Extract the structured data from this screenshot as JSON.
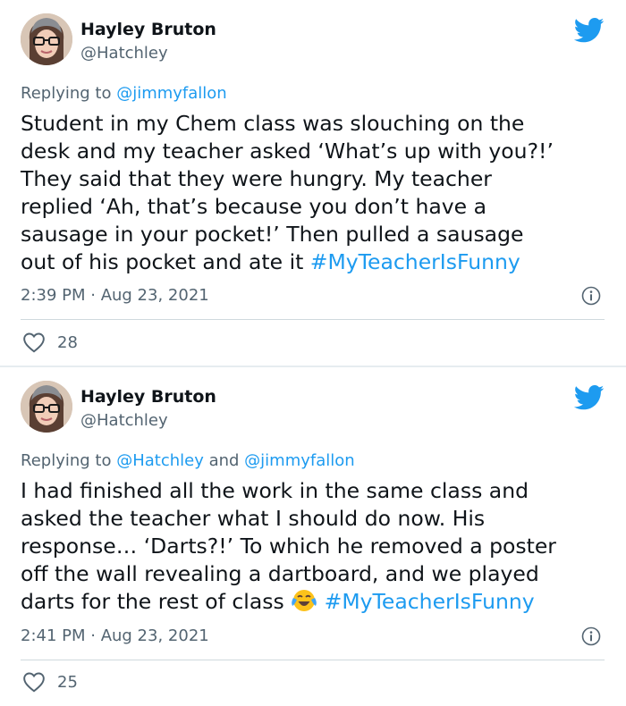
{
  "tweets": [
    {
      "name": "Hayley Bruton",
      "handle": "@Hatchley",
      "replying_prefix": "Replying to ",
      "replying_mentions": [
        "@jimmyfallon"
      ],
      "replying_joiner": "",
      "body_lines": [
        "Student in my Chem class was slouching on the",
        "desk and my teacher asked ‘What’s up with you?!’",
        "They said that they were hungry. My teacher",
        "replied ‘Ah, that’s because you don’t have a",
        "sausage in your pocket!’ Then pulled a sausage",
        "out of his pocket and ate it "
      ],
      "hashtag": "#MyTeacherIsFunny",
      "timestamp": "2:39 PM · Aug 23, 2021",
      "likes": "28"
    },
    {
      "name": "Hayley Bruton",
      "handle": "@Hatchley",
      "replying_prefix": "Replying to ",
      "replying_mentions": [
        "@Hatchley",
        "@jimmyfallon"
      ],
      "replying_joiner": " and ",
      "body_lines": [
        "I had finished all the work in the same class and",
        "asked the teacher what I should do now. His",
        "response… ‘Darts?!’ To which he removed a poster",
        "off the wall revealing a dartboard, and we played",
        "darts for the rest of class "
      ],
      "hashtag": "#MyTeacherIsFunny",
      "emoji": "tears-of-joy-emoji",
      "timestamp": "2:41 PM · Aug 23, 2021",
      "likes": "25"
    }
  ],
  "colors": {
    "link": "#1d9bf0",
    "secondary_text": "#536471",
    "primary_text": "#0f1419",
    "divider": "#cfd9de",
    "separator_background": "#e6ecf0"
  },
  "icons": [
    "twitter-bird-icon",
    "info-icon",
    "heart-icon",
    "avatar-photo"
  ]
}
